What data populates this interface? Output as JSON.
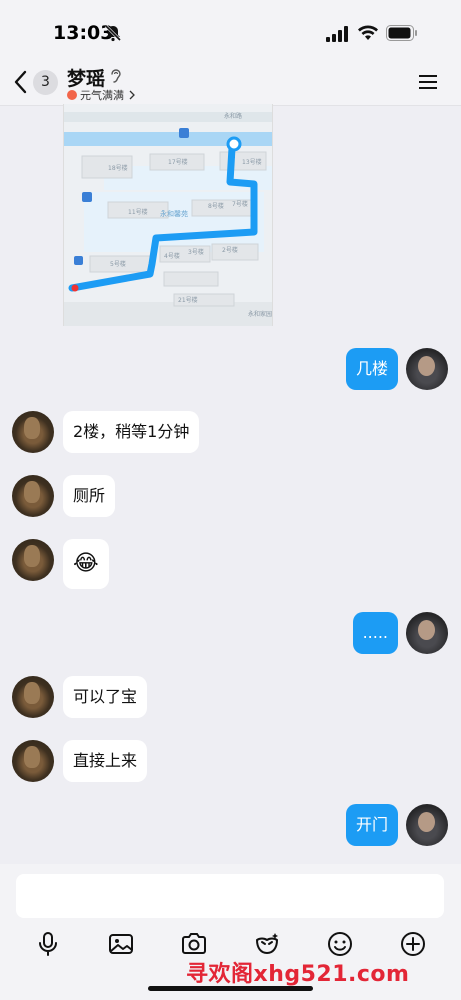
{
  "status": {
    "time": "13:03"
  },
  "header": {
    "unread_count": "3",
    "name": "梦瑶",
    "status_text": "元气满满"
  },
  "map": {
    "labels": {
      "l1": "永和路",
      "l2": "18号楼",
      "l3": "17号楼",
      "l4": "13号楼",
      "l5": "11号楼",
      "l6": "永和馨苑",
      "l7": "8号楼",
      "l8": "7号楼",
      "l9": "4号楼",
      "l10": "3号楼",
      "l11": "2号楼",
      "l12": "5号楼",
      "l13": "21号楼",
      "l14": "永和家园"
    }
  },
  "messages": [
    {
      "side": "right",
      "text": "几楼"
    },
    {
      "side": "left",
      "text": "2楼，稍等1分钟"
    },
    {
      "side": "left",
      "text": "厕所"
    },
    {
      "side": "left",
      "text": "😂"
    },
    {
      "side": "right",
      "text": "....."
    },
    {
      "side": "left",
      "text": "可以了宝"
    },
    {
      "side": "left",
      "text": "直接上来"
    },
    {
      "side": "right",
      "text": "开门"
    }
  ],
  "toolbar": {
    "icons": [
      "microphone-icon",
      "image-icon",
      "camera-icon",
      "sticker-icon",
      "emoji-icon",
      "plus-icon"
    ]
  },
  "watermark": "寻欢阁xhg521.com",
  "colors": {
    "bubble_right": "#1c9cf4",
    "bubble_left": "#ffffff",
    "background": "#eeeef3",
    "route": "#1c9cf4"
  }
}
